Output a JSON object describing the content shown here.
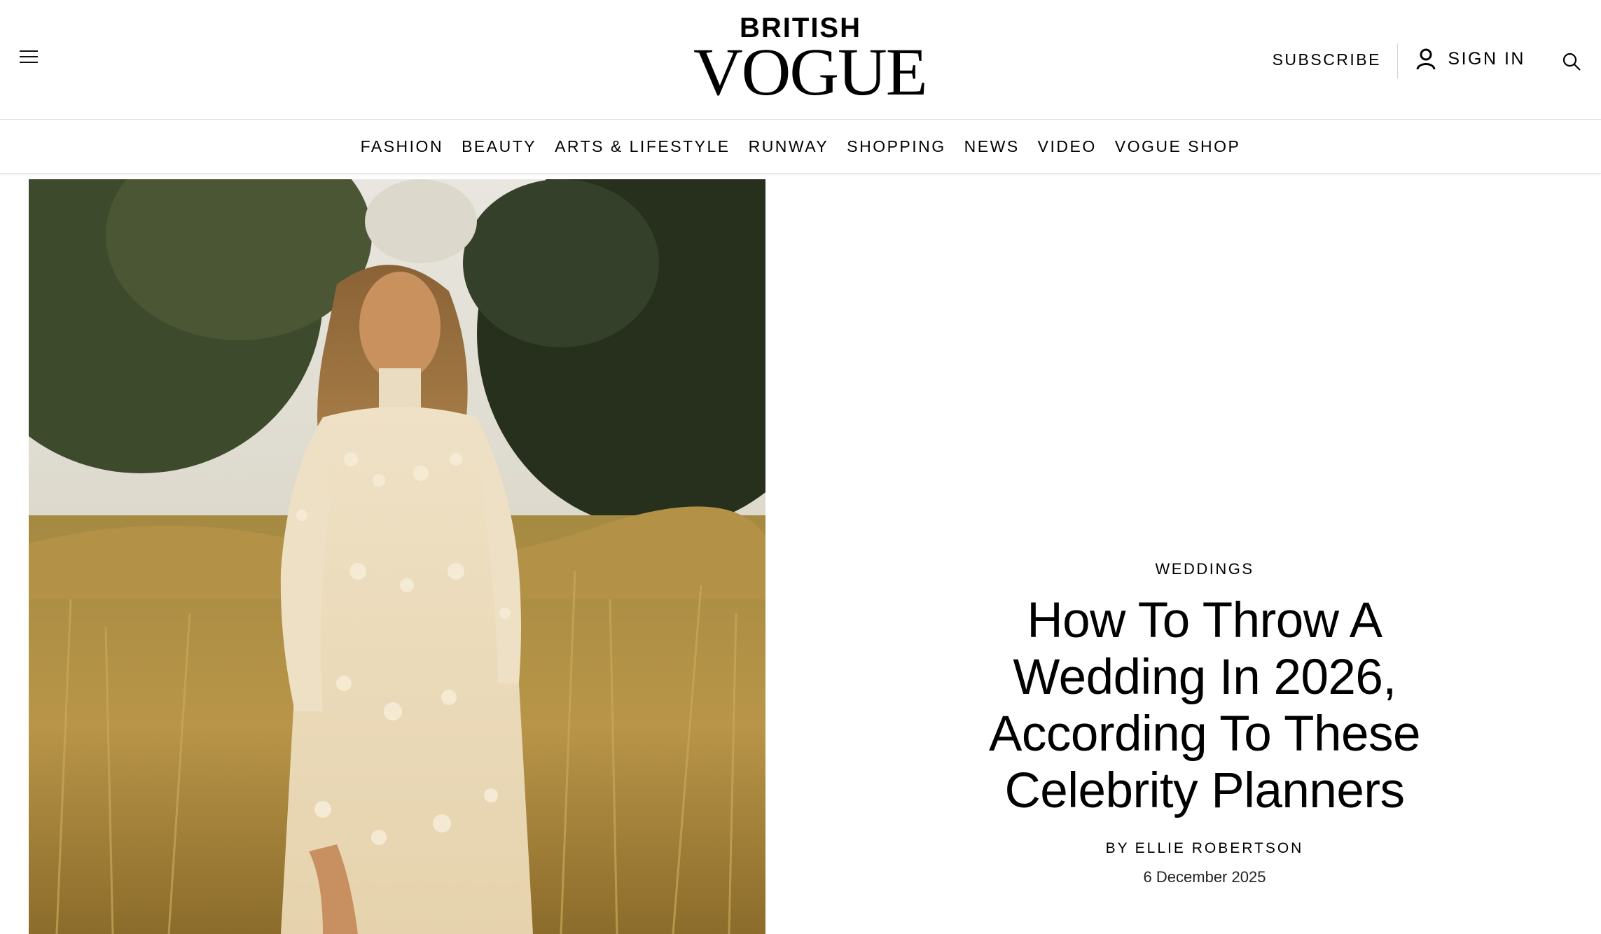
{
  "header": {
    "brand_top": "BRITISH",
    "brand_main": "VOGUE",
    "subscribe_label": "SUBSCRIBE",
    "signin_label": "SIGN IN",
    "icons": [
      "menu-icon",
      "user-icon",
      "search-icon"
    ]
  },
  "nav": {
    "items": [
      {
        "label": "FASHION"
      },
      {
        "label": "BEAUTY"
      },
      {
        "label": "ARTS & LIFESTYLE"
      },
      {
        "label": "RUNWAY"
      },
      {
        "label": "SHOPPING"
      },
      {
        "label": "NEWS"
      },
      {
        "label": "VIDEO"
      },
      {
        "label": "VOGUE SHOP"
      }
    ]
  },
  "article": {
    "category": "WEDDINGS",
    "title": "How To Throw A Wedding In 2026, According To These Celebrity Planners",
    "byline_prefix": "BY",
    "author": "ELLIE ROBERTSON",
    "date": "6 December 2025"
  },
  "colors": {
    "text": "#000000",
    "background": "#ffffff",
    "divider": "#e2e2e2"
  }
}
